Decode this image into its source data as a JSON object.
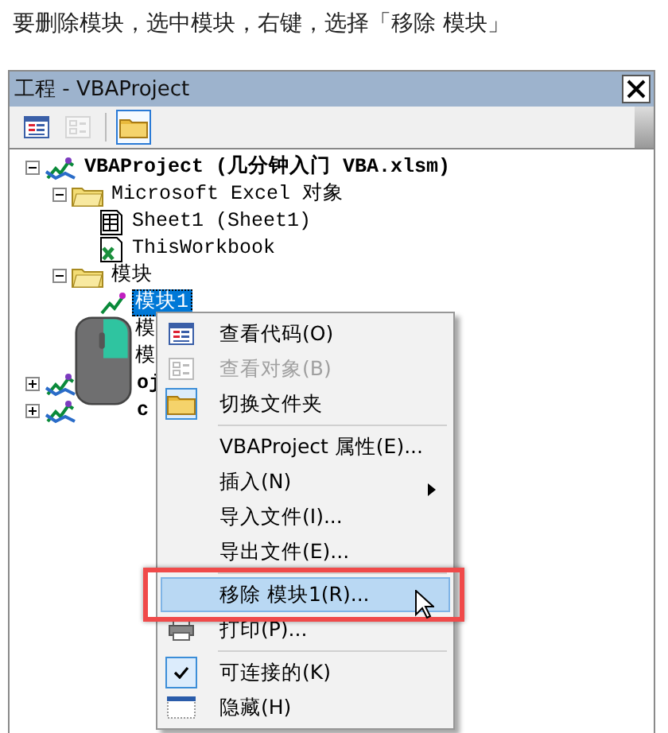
{
  "caption": "要删除模块，选中模块，右键，选择「移除 模块」",
  "window": {
    "title": "工程 - VBAProject"
  },
  "toolbar": [
    {
      "kind": "code",
      "selected": false,
      "disabled": false
    },
    {
      "kind": "object",
      "selected": false,
      "disabled": true
    },
    {
      "kind": "folder",
      "selected": true,
      "disabled": false
    }
  ],
  "tree": [
    {
      "kind": "project",
      "label": "VBAProject (几分钟入门 VBA.xlsm)",
      "expanded": true,
      "selected": false,
      "children": [
        {
          "kind": "folder",
          "label": "Microsoft Excel 对象",
          "expanded": true,
          "selected": false,
          "children": [
            {
              "kind": "sheet",
              "label": "Sheet1 (Sheet1)",
              "selected": false
            },
            {
              "kind": "workbook",
              "label": "ThisWorkbook",
              "selected": false
            }
          ]
        },
        {
          "kind": "folder",
          "label": "模块",
          "expanded": true,
          "selected": false,
          "children": [
            {
              "kind": "module",
              "label": "模块1",
              "selected": true
            },
            {
              "kind": "module",
              "label": "模",
              "selected": false
            },
            {
              "kind": "module",
              "label": "模",
              "selected": false
            }
          ]
        }
      ]
    },
    {
      "kind": "project",
      "label": "oj",
      "expanded": false,
      "selected": false
    },
    {
      "kind": "project",
      "label": "c",
      "expanded": false,
      "selected": false
    }
  ],
  "menu": {
    "groups": [
      [
        {
          "kind": "code",
          "label": "查看代码(O)",
          "disabled": false,
          "selected": false,
          "submenu": false
        },
        {
          "kind": "object",
          "label": "查看对象(B)",
          "disabled": true,
          "selected": false,
          "submenu": false
        },
        {
          "kind": "folder",
          "label": "切换文件夹",
          "disabled": false,
          "selected": false,
          "submenu": false
        }
      ],
      [
        {
          "kind": "plain",
          "label": "VBAProject 属性(E)...",
          "disabled": false,
          "selected": false,
          "submenu": false
        },
        {
          "kind": "plain",
          "label": "插入(N)",
          "disabled": false,
          "selected": false,
          "submenu": true
        },
        {
          "kind": "plain",
          "label": "导入文件(I)...",
          "disabled": false,
          "selected": false,
          "submenu": false
        },
        {
          "kind": "plain",
          "label": "导出文件(E)...",
          "disabled": false,
          "selected": false,
          "submenu": false
        }
      ],
      [
        {
          "kind": "plain",
          "label": "移除 模块1(R)...",
          "disabled": false,
          "selected": true,
          "submenu": false
        },
        {
          "kind": "print",
          "label": "打印(P)...",
          "disabled": false,
          "selected": false,
          "submenu": false
        }
      ],
      [
        {
          "kind": "check",
          "label": "可连接的(K)",
          "disabled": false,
          "selected": false,
          "checked": true,
          "submenu": false
        },
        {
          "kind": "window",
          "label": "隐藏(H)",
          "disabled": false,
          "selected": false,
          "submenu": false
        }
      ]
    ]
  }
}
